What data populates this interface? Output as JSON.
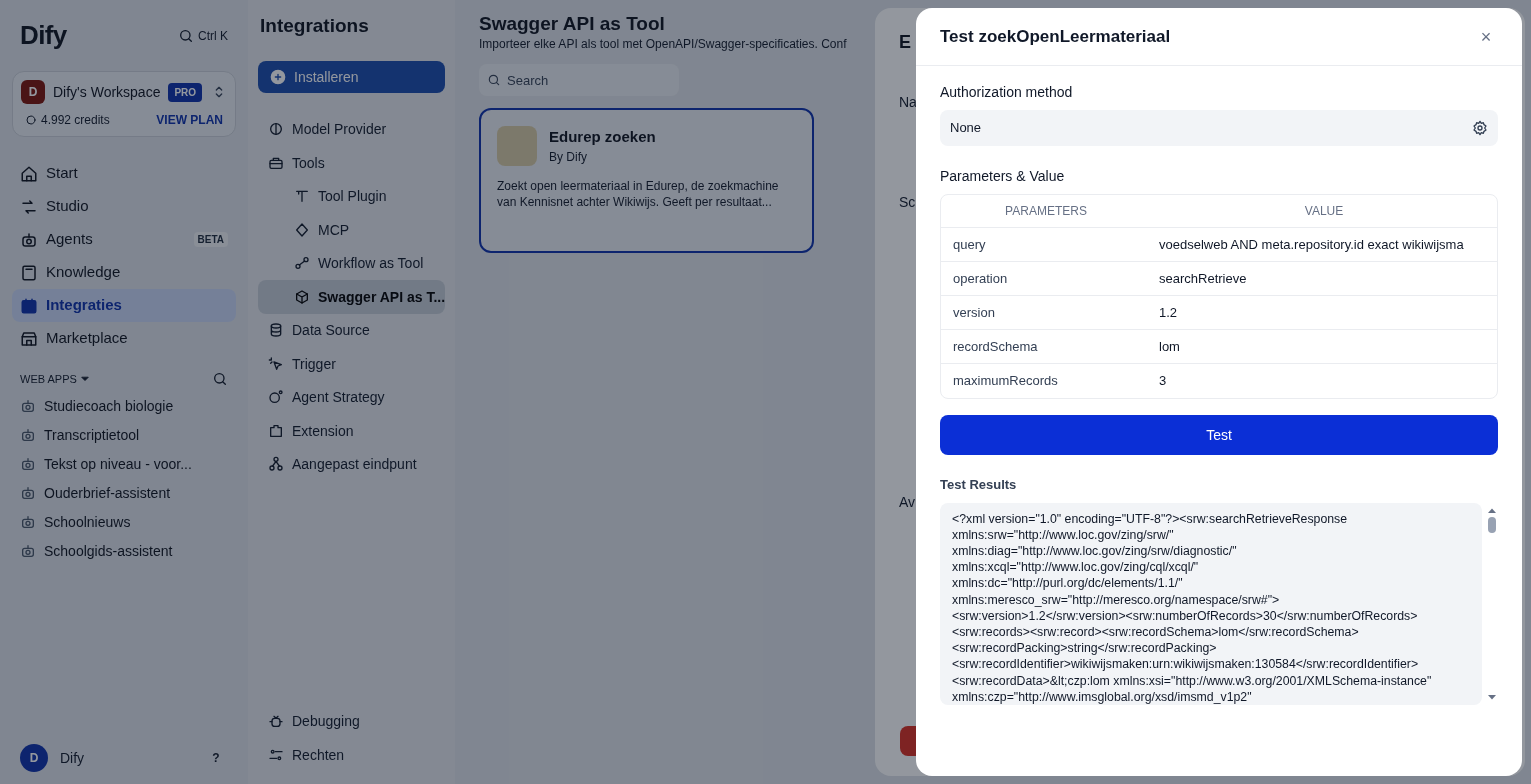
{
  "sidebar": {
    "logo": "Dify",
    "shortcut": "Ctrl K",
    "workspace": {
      "avatar": "D",
      "name": "Dify's Workspace",
      "badge": "PRO"
    },
    "credits": "4.992 credits",
    "view_plan": "VIEW PLAN",
    "nav": [
      {
        "label": "Start",
        "selected": false
      },
      {
        "label": "Studio",
        "selected": false
      },
      {
        "label": "Agents",
        "selected": false,
        "badge": "BETA"
      },
      {
        "label": "Knowledge",
        "selected": false
      },
      {
        "label": "Integraties",
        "selected": true
      },
      {
        "label": "Marketplace",
        "selected": false
      }
    ],
    "web_apps_label": "WEB APPS",
    "apps": [
      "Studiecoach biologie",
      "Transcriptietool",
      "Tekst op niveau - voor...",
      "Ouderbrief-assistent",
      "Schoolnieuws",
      "Schoolgids-assistent"
    ],
    "user": {
      "avatar": "D",
      "name": "Dify"
    },
    "help": "?"
  },
  "integrations": {
    "title": "Integrations",
    "install": "Installeren",
    "items": [
      {
        "label": "Model Provider",
        "selected": false
      },
      {
        "label": "Tools",
        "selected": false,
        "children": [
          {
            "label": "Tool Plugin",
            "selected": false
          },
          {
            "label": "MCP",
            "selected": false
          },
          {
            "label": "Workflow as Tool",
            "selected": false
          },
          {
            "label": "Swagger API as T...",
            "selected": true
          }
        ]
      },
      {
        "label": "Data Source",
        "selected": false
      },
      {
        "label": "Trigger",
        "selected": false
      },
      {
        "label": "Agent Strategy",
        "selected": false
      },
      {
        "label": "Extension",
        "selected": false
      },
      {
        "label": "Aangepast eindpunt",
        "selected": false
      }
    ],
    "footer_items": [
      "Debugging",
      "Rechten"
    ]
  },
  "main": {
    "title": "Swagger API as Tool",
    "subtitle": "Importeer elke API als tool met OpenAPI/Swagger-specificaties. Conf",
    "search_placeholder": "Search",
    "cards": [
      {
        "name": "Edurep zoeken",
        "author": "By Dify",
        "description": "Zoekt open leermateriaal in Edurep, de zoekmachine van Kennisnet achter Wikiwijs. Geeft per resultaat...",
        "selected": true
      }
    ]
  },
  "edit_drawer": {
    "title": "E",
    "labels": [
      "Na",
      "Sc",
      "Av"
    ]
  },
  "modal": {
    "title": "Test zoekOpenLeermateriaal",
    "close": "×",
    "auth_label": "Authorization method",
    "auth_value": "None",
    "params_label": "Parameters & Value",
    "columns": [
      "PARAMETERS",
      "VALUE"
    ],
    "rows": [
      {
        "name": "query",
        "value": "voedselweb AND meta.repository.id exact wikiwijsma"
      },
      {
        "name": "operation",
        "value": "searchRetrieve"
      },
      {
        "name": "version",
        "value": "1.2"
      },
      {
        "name": "recordSchema",
        "value": "lom"
      },
      {
        "name": "maximumRecords",
        "value": "3"
      }
    ],
    "test_button": "Test",
    "results_label": "Test Results",
    "results": [
      "<?xml version=\"1.0\" encoding=\"UTF-8\"?><srw:searchRetrieveResponse",
      "xmlns:srw=\"http://www.loc.gov/zing/srw/\"",
      "xmlns:diag=\"http://www.loc.gov/zing/srw/diagnostic/\"",
      "xmlns:xcql=\"http://www.loc.gov/zing/cql/xcql/\"",
      "xmlns:dc=\"http://purl.org/dc/elements/1.1/\"",
      "xmlns:meresco_srw=\"http://meresco.org/namespace/srw#\">",
      "<srw:version>1.2</srw:version><srw:numberOfRecords>30</srw:numberOfRecords>",
      "<srw:records><srw:record><srw:recordSchema>lom</srw:recordSchema>",
      "<srw:recordPacking>string</srw:recordPacking>",
      "<srw:recordIdentifier>wikiwijsmaken:urn:wikiwijsmaken:130584</srw:recordIdentifier>",
      "<srw:recordData>&lt;czp:lom xmlns:xsi=\"http://www.w3.org/2001/XMLSchema-instance\"",
      "xmlns:czp=\"http://www.imsglobal.org/xsd/imsmd_v1p2\""
    ]
  }
}
